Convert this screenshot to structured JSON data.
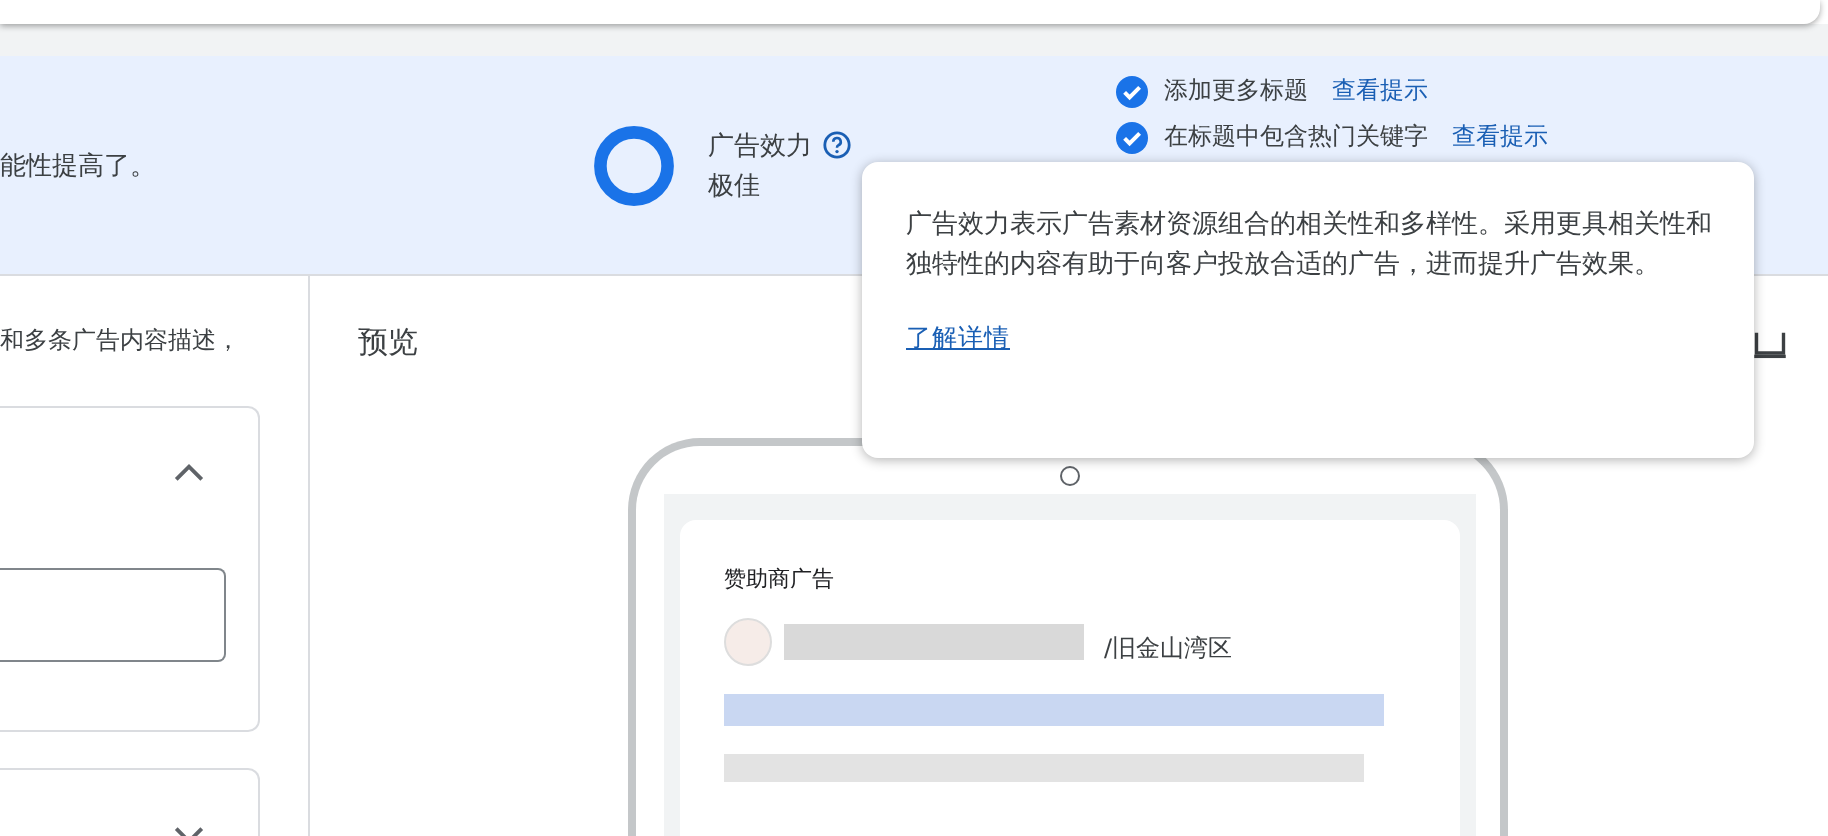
{
  "banner": {
    "message": "能性提高了。",
    "strength": {
      "label": "广告效力",
      "rating": "极佳"
    },
    "tips": [
      {
        "text": "添加更多标题",
        "link": "查看提示",
        "checked": true
      },
      {
        "text": "在标题中包含热门关键字",
        "link": "查看提示",
        "checked": true
      }
    ]
  },
  "editor": {
    "description": "和多条广告内容描述，",
    "sections": [
      {
        "expanded": true
      },
      {
        "expanded": false
      }
    ]
  },
  "preview": {
    "title": "预览",
    "ad": {
      "sponsored_label": "赞助商广告",
      "location": "/旧金山湾区"
    }
  },
  "tooltip": {
    "text": "广告效力表示广告素材资源组合的相关性和多样性。采用更具相关性和独特性的内容有助于向客户投放合适的广告，进而提升广告效果。",
    "link": "了解详情"
  }
}
